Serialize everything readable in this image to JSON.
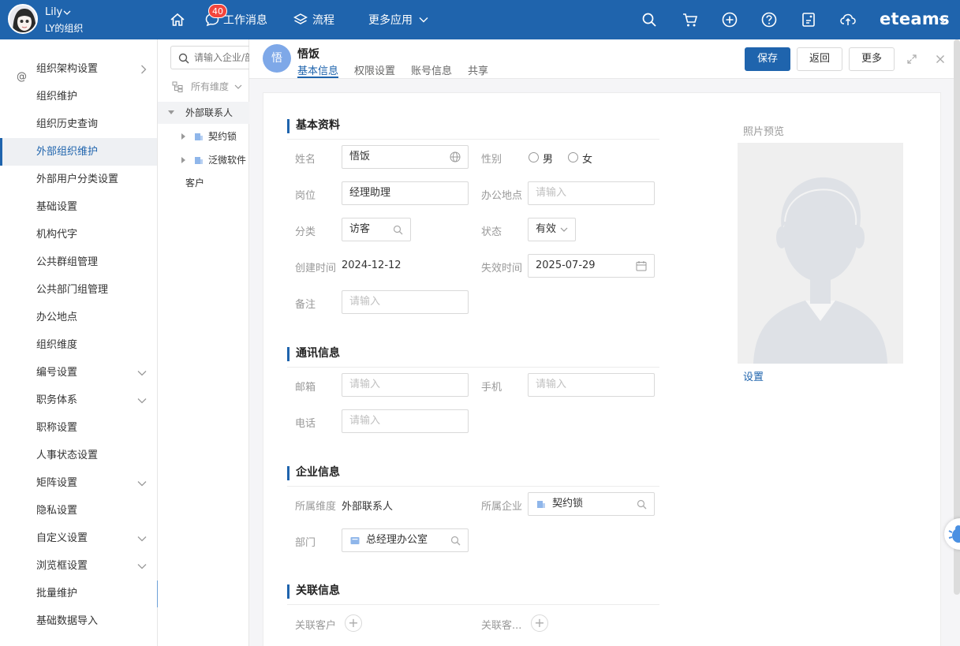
{
  "topbar": {
    "user_name": "Lily",
    "org_name": "LY的组织",
    "message_count": "40",
    "nav_messages": "工作消息",
    "nav_flow": "流程",
    "nav_more_apps": "更多应用",
    "brand": "eteams",
    "tools": [
      "search-icon",
      "cart-icon",
      "add-circle-icon",
      "help-icon",
      "notes-icon",
      "cloud-icon"
    ],
    "accent_color": "#1f64ad"
  },
  "sidebar": {
    "items": [
      {
        "label": "组织架构设置"
      },
      {
        "label": "组织维护"
      },
      {
        "label": "组织历史查询"
      },
      {
        "label": "外部组织维护"
      },
      {
        "label": "外部用户分类设置"
      },
      {
        "label": "基础设置"
      },
      {
        "label": "机构代字"
      },
      {
        "label": "公共群组管理"
      },
      {
        "label": "公共部门组管理"
      },
      {
        "label": "办公地点"
      },
      {
        "label": "组织维度"
      },
      {
        "label": "编号设置"
      },
      {
        "label": "职务体系"
      },
      {
        "label": "职称设置"
      },
      {
        "label": "人事状态设置"
      },
      {
        "label": "矩阵设置"
      },
      {
        "label": "隐私设置"
      },
      {
        "label": "自定义设置"
      },
      {
        "label": "浏览框设置"
      },
      {
        "label": "批量维护"
      },
      {
        "label": "基础数据导入"
      }
    ],
    "active": "外部组织维护"
  },
  "tree": {
    "search_placeholder": "请输入企业/部",
    "dimension": "所有维度",
    "nodes": [
      {
        "label": "外部联系人"
      },
      {
        "label": "契约锁"
      },
      {
        "label": "泛微软件"
      },
      {
        "label": "客户"
      }
    ]
  },
  "record": {
    "avatar_text": "悟",
    "name": "悟饭",
    "tabs": [
      "基本信息",
      "权限设置",
      "账号信息",
      "共享"
    ],
    "active_tab": "基本信息",
    "buttons": {
      "save": "保存",
      "back": "返回",
      "more": "更多"
    }
  },
  "basic": {
    "section": "基本资料",
    "name_label": "姓名",
    "name_value": "悟饭",
    "gender_label": "性别",
    "gender_male": "男",
    "gender_female": "女",
    "position_label": "岗位",
    "position_value": "经理助理",
    "office_label": "办公地点",
    "category_label": "分类",
    "category_value": "访客",
    "status_label": "状态",
    "status_value": "有效",
    "created_label": "创建时间",
    "created_value": "2024-12-12",
    "expire_label": "失效时间",
    "expire_value": "2025-07-29",
    "remark_label": "备注",
    "placeholder": "请输入"
  },
  "photo": {
    "label": "照片预览",
    "set": "设置"
  },
  "contact": {
    "section": "通讯信息",
    "email_label": "邮箱",
    "mobile_label": "手机",
    "phone_label": "电话"
  },
  "company": {
    "section": "企业信息",
    "dimension_label": "所属维度",
    "dimension_value": "外部联系人",
    "company_label": "所属企业",
    "company_value": "契约锁",
    "dept_label": "部门",
    "dept_value": "总经理办公室"
  },
  "related": {
    "section": "关联信息",
    "customer_label": "关联客户",
    "other_label": "关联客..."
  }
}
